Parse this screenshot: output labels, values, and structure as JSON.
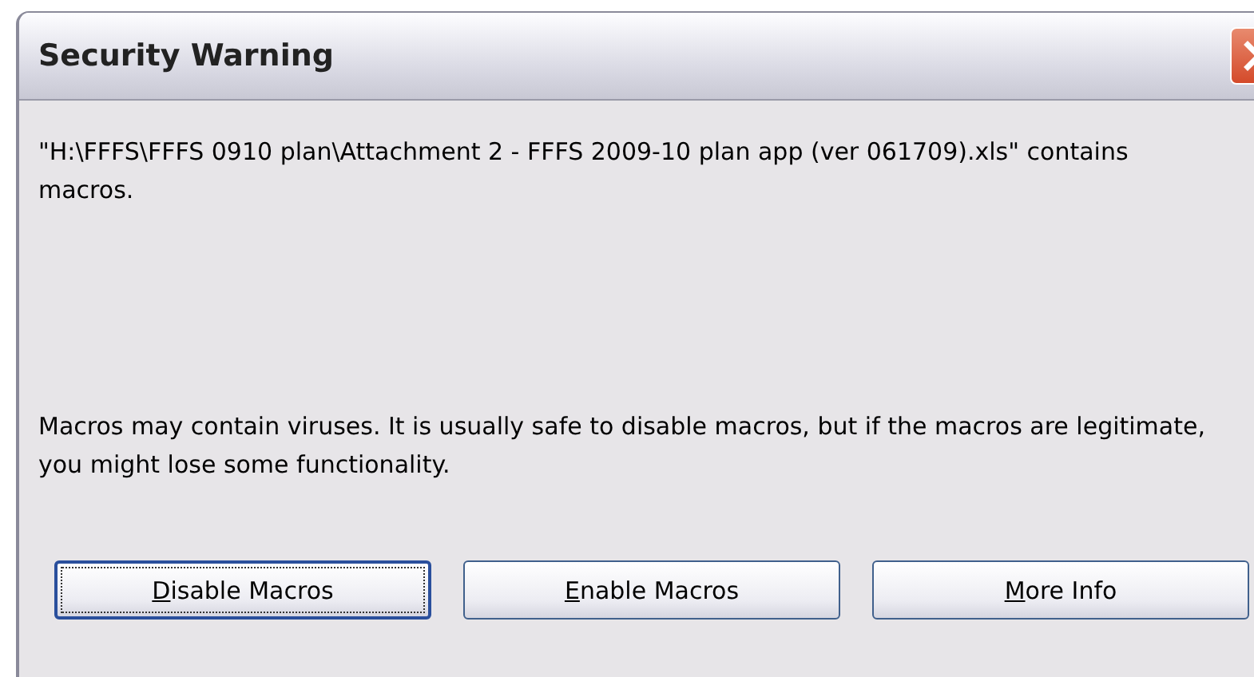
{
  "window": {
    "title": "Security Warning"
  },
  "message": "\"H:\\FFFS\\FFFS 0910 plan\\Attachment 2 - FFFS 2009-10 plan app (ver 061709).xls\" contains macros.",
  "warning": "Macros may contain viruses. It is usually safe to disable macros, but if the macros are legitimate, you might lose some functionality.",
  "buttons": [
    {
      "access_key": "D",
      "rest": "isable Macros",
      "focused": true
    },
    {
      "access_key": "E",
      "rest": "nable Macros",
      "focused": false
    },
    {
      "access_key": "M",
      "rest": "ore Info",
      "focused": false
    }
  ]
}
